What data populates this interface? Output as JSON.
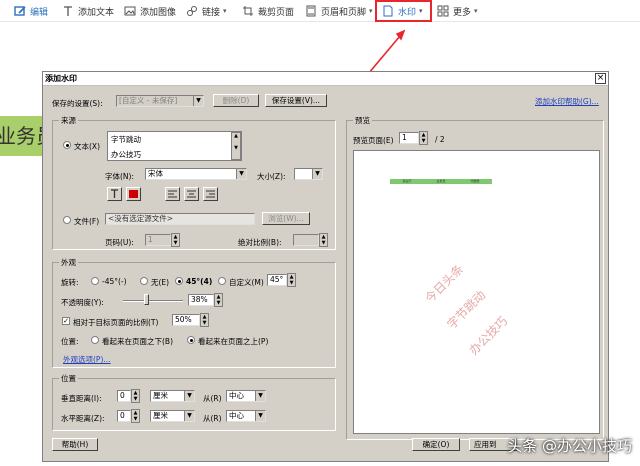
{
  "toolbar": {
    "items": [
      {
        "label": "编辑",
        "icon": "edit-icon"
      },
      {
        "label": "添加文本",
        "icon": "text-icon"
      },
      {
        "label": "添加图像",
        "icon": "image-icon"
      },
      {
        "label": "链接",
        "icon": "link-icon"
      },
      {
        "label": "裁剪页面",
        "icon": "crop-icon"
      },
      {
        "label": "页眉和页脚",
        "icon": "header-footer-icon"
      },
      {
        "label": "水印",
        "icon": "watermark-icon"
      },
      {
        "label": "更多",
        "icon": "more-icon"
      }
    ]
  },
  "background_doc": {
    "text": "业务员"
  },
  "dialog": {
    "title": "添加水印",
    "saved_label": "保存的设置(S):",
    "saved_value": "[自定义 - 未保存]",
    "delete_label": "删除(D)",
    "save_settings_label": "保存设置(V)...",
    "help_link": "添加水印帮助(G)...",
    "source": {
      "title": "来源",
      "text_label": "文本(X)",
      "text_lines": [
        "字节跳动",
        "办公技巧"
      ],
      "font_label": "字体(N):",
      "font_value": "宋体",
      "size_label": "大小(Z):",
      "size_value": "",
      "file_label": "文件(F)",
      "file_value": "<没有选定源文件>",
      "browse_label": "浏览(W)...",
      "page_label": "页码(U):",
      "page_value": "1",
      "scale_label": "绝对比例(B):",
      "scale_value": ""
    },
    "appearance": {
      "title": "外观",
      "rotate_label": "旋转:",
      "rotate_options": [
        "-45°(-)",
        "无(E)",
        "45°(4)",
        "自定义(M)"
      ],
      "rotate_custom_value": "45°",
      "rotate_selected": "45°(4)",
      "opacity_label": "不透明度(Y):",
      "opacity_value": "38%",
      "opacity_fraction": 0.38,
      "relative_label": "相对于目标页面的比例(T)",
      "relative_value": "50%",
      "position_label": "位置:",
      "position_options": [
        "看起来在页面之下(B)",
        "看起来在页面之上(P)"
      ],
      "position_selected": "看起来在页面之上(P)",
      "advanced_link": "外观选项(P)..."
    },
    "position": {
      "title": "位置",
      "vertical_label": "垂直距离(I):",
      "vertical_value": "0",
      "vertical_unit": "厘米",
      "vertical_from_label": "从(R)",
      "vertical_from": "中心",
      "horizontal_label": "水平距离(Z):",
      "horizontal_value": "0",
      "horizontal_unit": "厘米",
      "horizontal_from_label": "从(R)",
      "horizontal_from": "中心"
    },
    "preview": {
      "title": "预览",
      "page_label": "预览页面(E)",
      "page_value": "1",
      "page_total": "/ 2",
      "table_headers": [
        "营业厅",
        "业务员",
        "代缴费"
      ],
      "watermark_lines": [
        "今日头条",
        "字节跳动",
        "办公技巧"
      ]
    },
    "help_button": "帮助(H)",
    "ok_button": "确定(O)",
    "apply_button": "应用到"
  },
  "credit_watermark": "头条 @办公小技巧",
  "colors": {
    "highlight": "#e8262c",
    "arrow": "#e8262c",
    "doc_green": "#a9cf6a",
    "watermark_pink": "#e8a8a8"
  }
}
